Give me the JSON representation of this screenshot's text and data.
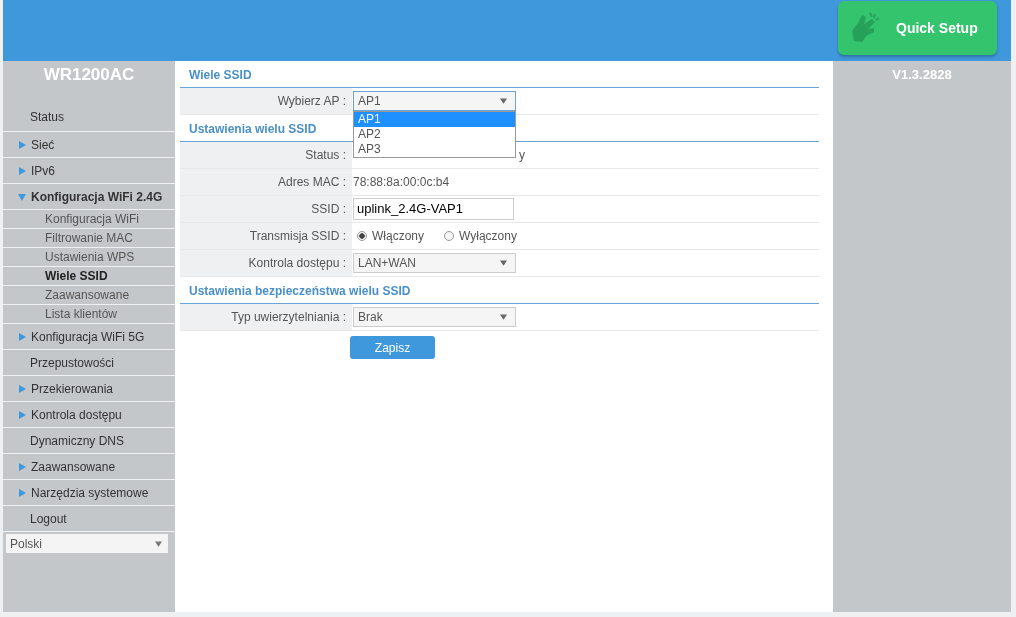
{
  "header": {
    "quick_setup": "Quick Setup"
  },
  "sidebar": {
    "title": "WR1200AC",
    "items": [
      {
        "label": "Status",
        "kind": "link"
      },
      {
        "label": "Sieć",
        "kind": "group",
        "expanded": false
      },
      {
        "label": "IPv6",
        "kind": "group",
        "expanded": false
      },
      {
        "label": "Konfiguracja WiFi 2.4G",
        "kind": "group",
        "expanded": true,
        "children": [
          {
            "label": "Konfiguracja WiFi",
            "selected": false
          },
          {
            "label": "Filtrowanie MAC",
            "selected": false
          },
          {
            "label": "Ustawienia WPS",
            "selected": false
          },
          {
            "label": "Wiele SSID",
            "selected": true
          },
          {
            "label": "Zaawansowane",
            "selected": false
          },
          {
            "label": "Lista klientów",
            "selected": false
          }
        ]
      },
      {
        "label": "Konfiguracja WiFi 5G",
        "kind": "group",
        "expanded": false
      },
      {
        "label": "Przepustowości",
        "kind": "link"
      },
      {
        "label": "Przekierowania",
        "kind": "group",
        "expanded": false
      },
      {
        "label": "Kontrola dostępu",
        "kind": "group",
        "expanded": false
      },
      {
        "label": "Dynamiczny DNS",
        "kind": "link"
      },
      {
        "label": "Zaawansowane",
        "kind": "group",
        "expanded": false
      },
      {
        "label": "Narzędzia systemowe",
        "kind": "group",
        "expanded": false
      },
      {
        "label": "Logout",
        "kind": "link"
      }
    ],
    "language": "Polski"
  },
  "version": "V1.3.2828",
  "sections": [
    {
      "title": "Wiele SSID",
      "rows": [
        {
          "kind": "select",
          "label": "Wybierz AP :",
          "value": "AP1",
          "open": true,
          "options": [
            {
              "label": "AP1",
              "selected": true
            },
            {
              "label": "AP2",
              "selected": false
            },
            {
              "label": "AP3",
              "selected": false
            }
          ]
        }
      ]
    },
    {
      "title": "Ustawienia wielu SSID",
      "rows": [
        {
          "kind": "text",
          "label": "Status :",
          "value": "y"
        },
        {
          "kind": "text",
          "label": "Adres MAC :",
          "value": "78:88:8a:00:0c:b4"
        },
        {
          "kind": "input",
          "label": "SSID :",
          "value": "uplink_2.4G-VAP1"
        },
        {
          "kind": "radio",
          "label": "Transmisja SSID :",
          "options": [
            {
              "label": "Włączony",
              "selected": true
            },
            {
              "label": "Wyłączony",
              "selected": false
            }
          ]
        },
        {
          "kind": "select",
          "label": "Kontrola dostępu :",
          "value": "LAN+WAN",
          "open": false
        }
      ]
    },
    {
      "title": "Ustawienia bezpieczeństwa wielu SSID",
      "rows": [
        {
          "kind": "select",
          "label": "Typ uwierzytelniania :",
          "value": "Brak",
          "open": false
        }
      ]
    }
  ],
  "save_button": "Zapisz"
}
